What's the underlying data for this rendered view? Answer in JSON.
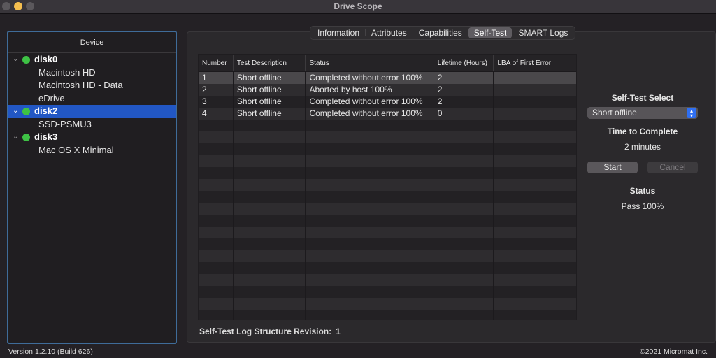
{
  "window": {
    "title": "Drive Scope"
  },
  "sidebar": {
    "header": "Device",
    "items": [
      {
        "type": "disk",
        "label": "disk0",
        "status_color": "#3ec245",
        "expanded": true,
        "selected": false
      },
      {
        "type": "volume",
        "label": "Macintosh HD"
      },
      {
        "type": "volume",
        "label": "Macintosh HD - Data"
      },
      {
        "type": "volume",
        "label": "eDrive"
      },
      {
        "type": "disk",
        "label": "disk2",
        "status_color": "#3ec245",
        "expanded": true,
        "selected": true
      },
      {
        "type": "volume",
        "label": "SSD-PSMU3"
      },
      {
        "type": "disk",
        "label": "disk3",
        "status_color": "#3ec245",
        "expanded": true,
        "selected": false
      },
      {
        "type": "volume",
        "label": "Mac OS X Minimal"
      }
    ]
  },
  "tabs": [
    {
      "label": "Information",
      "active": false
    },
    {
      "label": "Attributes",
      "active": false
    },
    {
      "label": "Capabilities",
      "active": false
    },
    {
      "label": "Self-Test",
      "active": true
    },
    {
      "label": "SMART Logs",
      "active": false
    }
  ],
  "table": {
    "columns": [
      "Number",
      "Test Description",
      "Status",
      "Lifetime (Hours)",
      "LBA of First Error"
    ],
    "rows": [
      [
        "1",
        "Short offline",
        "Completed without error 100%",
        "2",
        ""
      ],
      [
        "2",
        "Short offline",
        "Aborted by host 100%",
        "2",
        ""
      ],
      [
        "3",
        "Short offline",
        "Completed without error 100%",
        "2",
        ""
      ],
      [
        "4",
        "Short offline",
        "Completed without error 100%",
        "0",
        ""
      ]
    ],
    "selected_row": 0
  },
  "revision": {
    "label": "Self-Test Log Structure Revision:",
    "value": "1"
  },
  "self_test": {
    "select_label": "Self-Test Select",
    "selected_option": "Short offline",
    "time_label": "Time to Complete",
    "time_value": "2 minutes",
    "start_label": "Start",
    "cancel_label": "Cancel",
    "cancel_enabled": false,
    "status_label": "Status",
    "status_value": "Pass 100%"
  },
  "footer": {
    "version": "Version 1.2.10 (Build 626)",
    "copyright": "©2021 Micromat Inc."
  },
  "icons": {
    "chevron": "⌄",
    "select_arrows": "▴▾"
  }
}
